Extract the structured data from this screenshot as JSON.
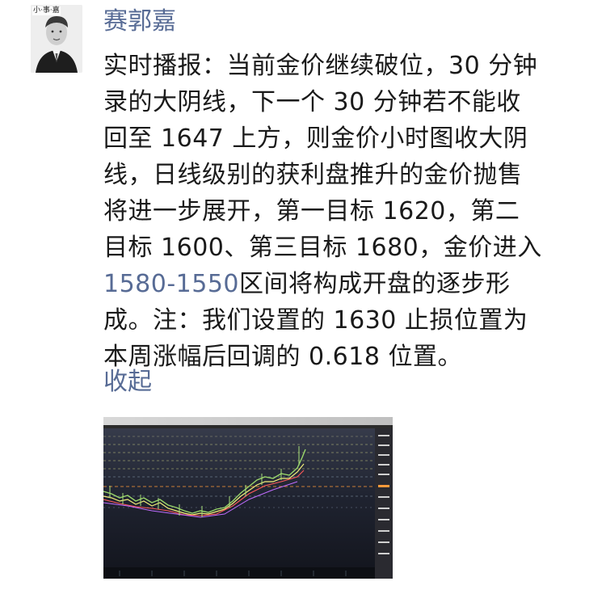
{
  "author": {
    "name": "赛郭嘉",
    "avatar_tag": "小·事·嘉"
  },
  "post": {
    "lines": [
      "实时播报：当前金价继续破位，30 分钟",
      "录的大阴线，下一个 30 分钟若不能收",
      "回至 1647 上方，则金价小时图收大阴",
      "线，日线级别的获利盘推升的金价抛售",
      "将进一步展开，第一目标 1620，第二",
      "目标 1600、第三目标 1680，金价进入"
    ],
    "link_text": "1580-1550",
    "line7_rest": "区间将构成开盘的逐步形",
    "tail_lines": [
      "成。注：我们设置的 1630 止损位置为",
      "本周涨幅后回调的 0.618 位置。"
    ]
  },
  "collapse_label": "收起",
  "colors": {
    "name": "#576b95",
    "link": "#576b95",
    "text": "#1a1a1a"
  }
}
